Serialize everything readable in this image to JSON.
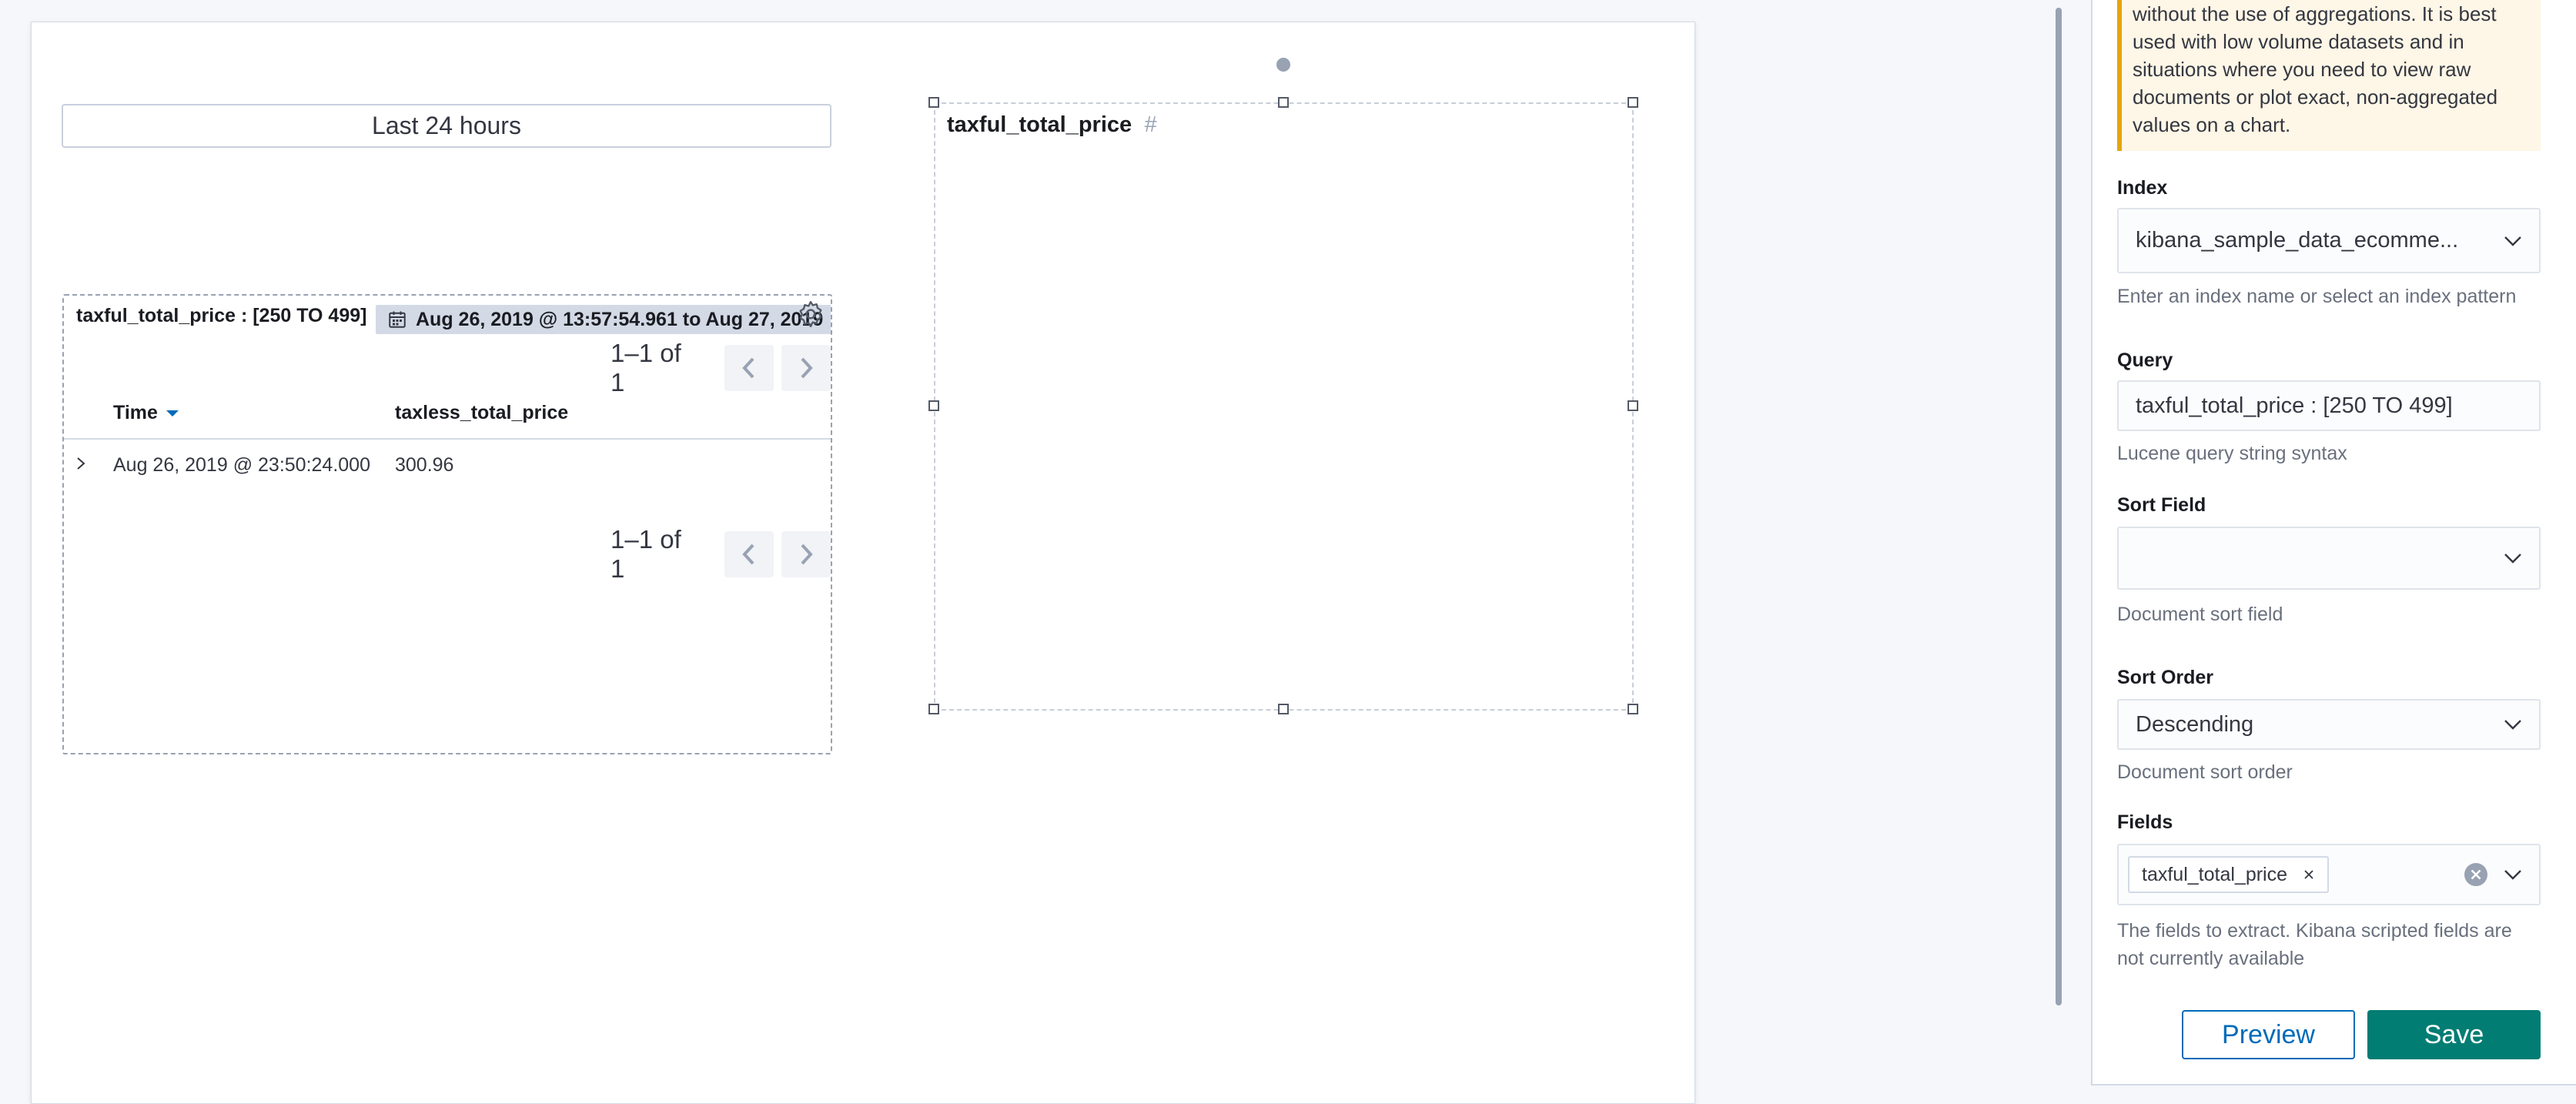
{
  "canvas": {
    "time_filter": {
      "label": "Last 24 hours"
    },
    "saved_search": {
      "panel_title": "taxful_total_price : [250 TO 499]",
      "time_range_badge": "Aug 26, 2019 @ 13:57:54.961 to Aug 27, 2019",
      "pagination_top": "1–1 of 1",
      "pagination_bottom": "1–1 of 1",
      "columns": [
        "Time",
        "taxless_total_price"
      ],
      "rows": [
        {
          "time": "Aug 26, 2019 @ 23:50:24.000",
          "taxless_total_price": "300.96"
        }
      ]
    },
    "chart_element": {
      "field_label": "taxful_total_price",
      "field_type_symbol": "#"
    }
  },
  "sidebar": {
    "callout_lines": [
      "without the use of aggregations. It is best",
      "used with low volume datasets and in",
      "situations where you need to view raw",
      "documents or plot exact, non-aggregated",
      "values on a chart."
    ],
    "index": {
      "label": "Index",
      "value": "kibana_sample_data_ecomme...",
      "help": "Enter an index name or select an index pattern"
    },
    "query": {
      "label": "Query",
      "value": "taxful_total_price : [250 TO 499]",
      "help": "Lucene query string syntax"
    },
    "sort_field": {
      "label": "Sort Field",
      "value": "",
      "help": "Document sort field"
    },
    "sort_order": {
      "label": "Sort Order",
      "value": "Descending",
      "help": "Document sort order"
    },
    "fields": {
      "label": "Fields",
      "selected": [
        "taxful_total_price"
      ],
      "help_line1": "The fields to extract. Kibana scripted fields are",
      "help_line2": "not currently available"
    },
    "preview_label": "Preview",
    "save_label": "Save"
  },
  "colors": {
    "primary": "#006bb8",
    "save": "#017d73",
    "callout_accent": "#e6a500",
    "callout_bg": "#fef6e6"
  }
}
